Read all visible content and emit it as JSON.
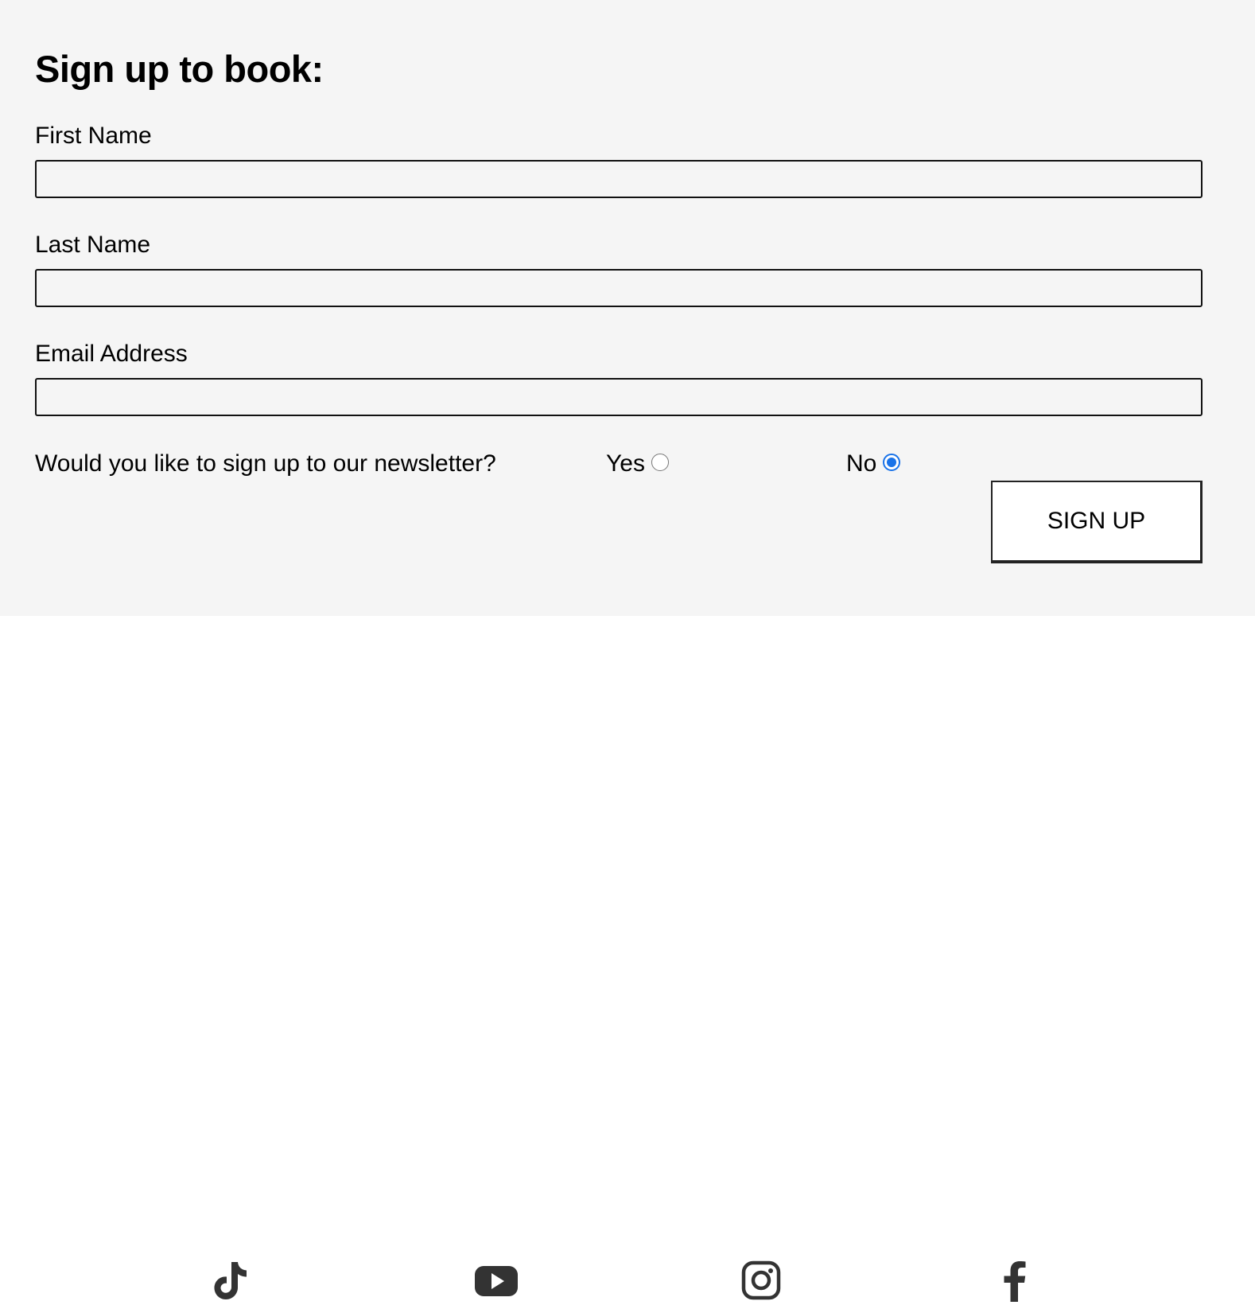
{
  "form": {
    "title": "Sign up to book:",
    "fields": [
      {
        "label": "First Name",
        "value": "",
        "placeholder": ""
      },
      {
        "label": "Last Name",
        "value": "",
        "placeholder": ""
      },
      {
        "label": "Email Address",
        "value": "",
        "placeholder": ""
      }
    ],
    "newsletter": {
      "question": "Would you like to sign up to our newsletter?",
      "options": [
        {
          "label": "Yes",
          "selected": false
        },
        {
          "label": "No",
          "selected": true
        }
      ]
    },
    "submit_label": "SIGN UP"
  },
  "footer": {
    "social_icons": [
      "tiktok-icon",
      "youtube-icon",
      "instagram-icon",
      "facebook-icon"
    ],
    "icon_color": "#333333"
  },
  "colors": {
    "form_background": "#f5f5f5",
    "page_background": "#ffffff",
    "radio_selected": "#1a73e8"
  }
}
